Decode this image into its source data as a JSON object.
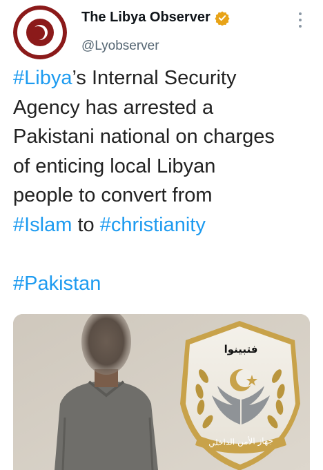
{
  "author": {
    "display_name": "The Libya Observer",
    "handle": "@Lyobserver",
    "avatar_icon": "libya-observer-logo",
    "verified_icon": "verified-badge-icon"
  },
  "tweet": {
    "lines": [
      [
        {
          "text": "#Libya",
          "tag": true
        },
        {
          "text": "’s Internal Security",
          "tag": false
        }
      ],
      [
        {
          "text": "Agency has arrested a",
          "tag": false
        }
      ],
      [
        {
          "text": "Pakistani national on charges",
          "tag": false
        }
      ],
      [
        {
          "text": "of enticing local Libyan",
          "tag": false
        }
      ],
      [
        {
          "text": "people to convert from",
          "tag": false
        }
      ],
      [
        {
          "text": "#Islam",
          "tag": true
        },
        {
          "text": " to ",
          "tag": false
        },
        {
          "text": "#christianity",
          "tag": true
        }
      ],
      [],
      [
        {
          "text": "#Pakistan",
          "tag": true
        }
      ]
    ]
  },
  "media": {
    "emblem_arabic_top": "فتبينوا",
    "emblem_arabic_bottom": "جهاز الأمن الداخلي"
  },
  "colors": {
    "hashtag": "#1d9bf0",
    "verified": "#e8a317",
    "logo_red": "#8b1a1a"
  }
}
